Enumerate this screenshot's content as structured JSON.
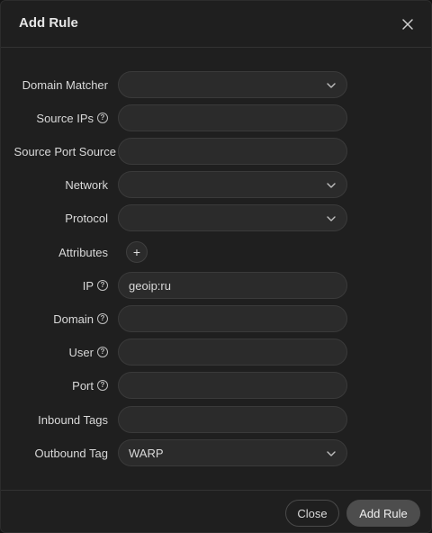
{
  "dialog": {
    "title": "Add Rule"
  },
  "form": {
    "domain_matcher": {
      "label": "Domain Matcher",
      "value": ""
    },
    "source_ips": {
      "label": "Source IPs",
      "value": ""
    },
    "source_port": {
      "label": "Source Port Source",
      "value": ""
    },
    "network": {
      "label": "Network",
      "value": ""
    },
    "protocol": {
      "label": "Protocol",
      "value": ""
    },
    "attributes": {
      "label": "Attributes",
      "add_label": "+"
    },
    "ip": {
      "label": "IP",
      "value": "geoip:ru"
    },
    "domain": {
      "label": "Domain",
      "value": ""
    },
    "user": {
      "label": "User",
      "value": ""
    },
    "port": {
      "label": "Port",
      "value": ""
    },
    "inbound_tags": {
      "label": "Inbound Tags",
      "value": ""
    },
    "outbound_tag": {
      "label": "Outbound Tag",
      "value": "WARP"
    }
  },
  "footer": {
    "close_label": "Close",
    "add_label": "Add Rule"
  },
  "icons": {
    "help": "question-circle-icon",
    "dropdown": "chevron-down-icon",
    "close": "close-icon",
    "add": "plus-icon"
  },
  "colors": {
    "background": "#1f1f1f",
    "field": "#2b2b2b",
    "primary_button": "#4d4d4d"
  }
}
